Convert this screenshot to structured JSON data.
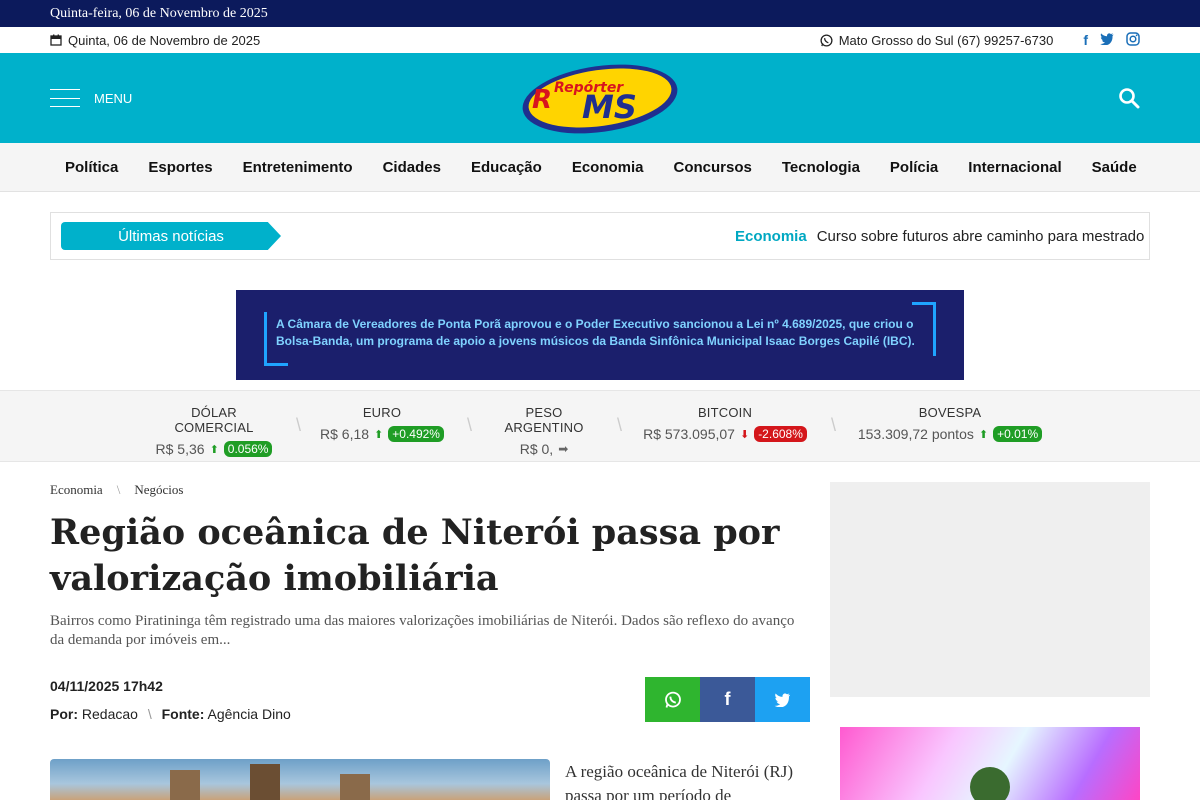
{
  "topstrip": {
    "date": "Quinta-feira, 06 de Novembro de 2025"
  },
  "infobar": {
    "date": "Quinta, 06 de Novembro de 2025",
    "contact": "Mato Grosso do Sul (67) 99257-6730",
    "social": [
      "f",
      "t",
      "◎"
    ]
  },
  "header": {
    "menu_label": "MENU",
    "logo_text_top": "Repórter",
    "logo_text_r": "R",
    "logo_text_ms": "MS"
  },
  "nav": [
    "Política",
    "Esportes",
    "Entretenimento",
    "Cidades",
    "Educação",
    "Economia",
    "Concursos",
    "Tecnologia",
    "Polícia",
    "Internacional",
    "Saúde"
  ],
  "ticker": {
    "label": "Últimas notícias",
    "category": "Economia",
    "headline": "Curso sobre futuros abre caminho para mestrado n"
  },
  "banner": {
    "text": "A Câmara de Vereadores de Ponta Porã aprovou e o Poder Executivo sancionou a Lei nº 4.689/2025, que criou o Bolsa-Banda, um programa de apoio a jovens músicos da Banda Sinfônica Municipal Isaac Borges Capilé (IBC)."
  },
  "currency": [
    {
      "name": "DÓLAR COMERCIAL",
      "value": "R$ 5,36",
      "trend": "up",
      "change": "0.056%"
    },
    {
      "name": "EURO",
      "value": "R$ 6,18",
      "trend": "up",
      "change": "+0.492%"
    },
    {
      "name": "PESO ARGENTINO",
      "value": "R$ 0,",
      "trend": "flat",
      "change": ""
    },
    {
      "name": "BITCOIN",
      "value": "R$ 573.095,07",
      "trend": "down",
      "change": "-2.608%"
    },
    {
      "name": "BOVESPA",
      "value": "153.309,72 pontos",
      "trend": "up",
      "change": "+0.01%"
    }
  ],
  "article": {
    "crumbs": [
      "Economia",
      "Negócios"
    ],
    "title": "Região oceânica de Niterói passa por valorização imobiliária",
    "lead": "Bairros como Piratininga têm registrado uma das maiores valorizações imobiliárias de Niterói. Dados são reflexo do avanço da demanda por imóveis em...",
    "date": "04/11/2025 17h42",
    "by_label": "Por:",
    "author": "Redacao",
    "source_label": "Fonte:",
    "source": "Agência Dino",
    "body": "A região oceânica de Niterói (RJ) passa por um período de"
  },
  "share": {
    "whatsapp": "✆",
    "facebook": "f",
    "twitter": "t"
  },
  "colors": {
    "topstrip": "#0c1a5c",
    "header": "#00b1cb",
    "up": "#1f9d25",
    "down": "#d4161b"
  }
}
